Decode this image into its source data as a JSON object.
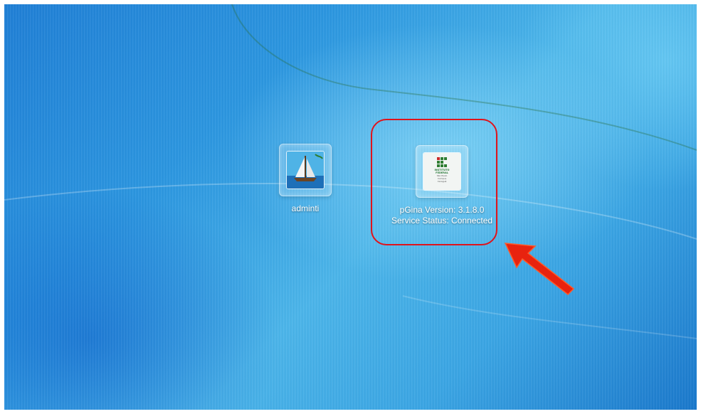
{
  "login_screen": {
    "user_tile": {
      "label": "adminti",
      "icon": "sailboat-picture-icon"
    },
    "pgina_tile": {
      "icon": "instituto-federal-logo-icon",
      "logo_lines": [
        "INSTITUTO",
        "FEDERAL",
        "São Paulo",
        "Campus",
        "Caraguá"
      ],
      "version_text": "pGina Version: 3.1.8.0",
      "status_text": "Service Status: Connected"
    }
  },
  "annotation": {
    "highlight_color": "#e0131b",
    "arrow_color": "#e8230f",
    "arrow_icon": "red-arrow-icon"
  }
}
